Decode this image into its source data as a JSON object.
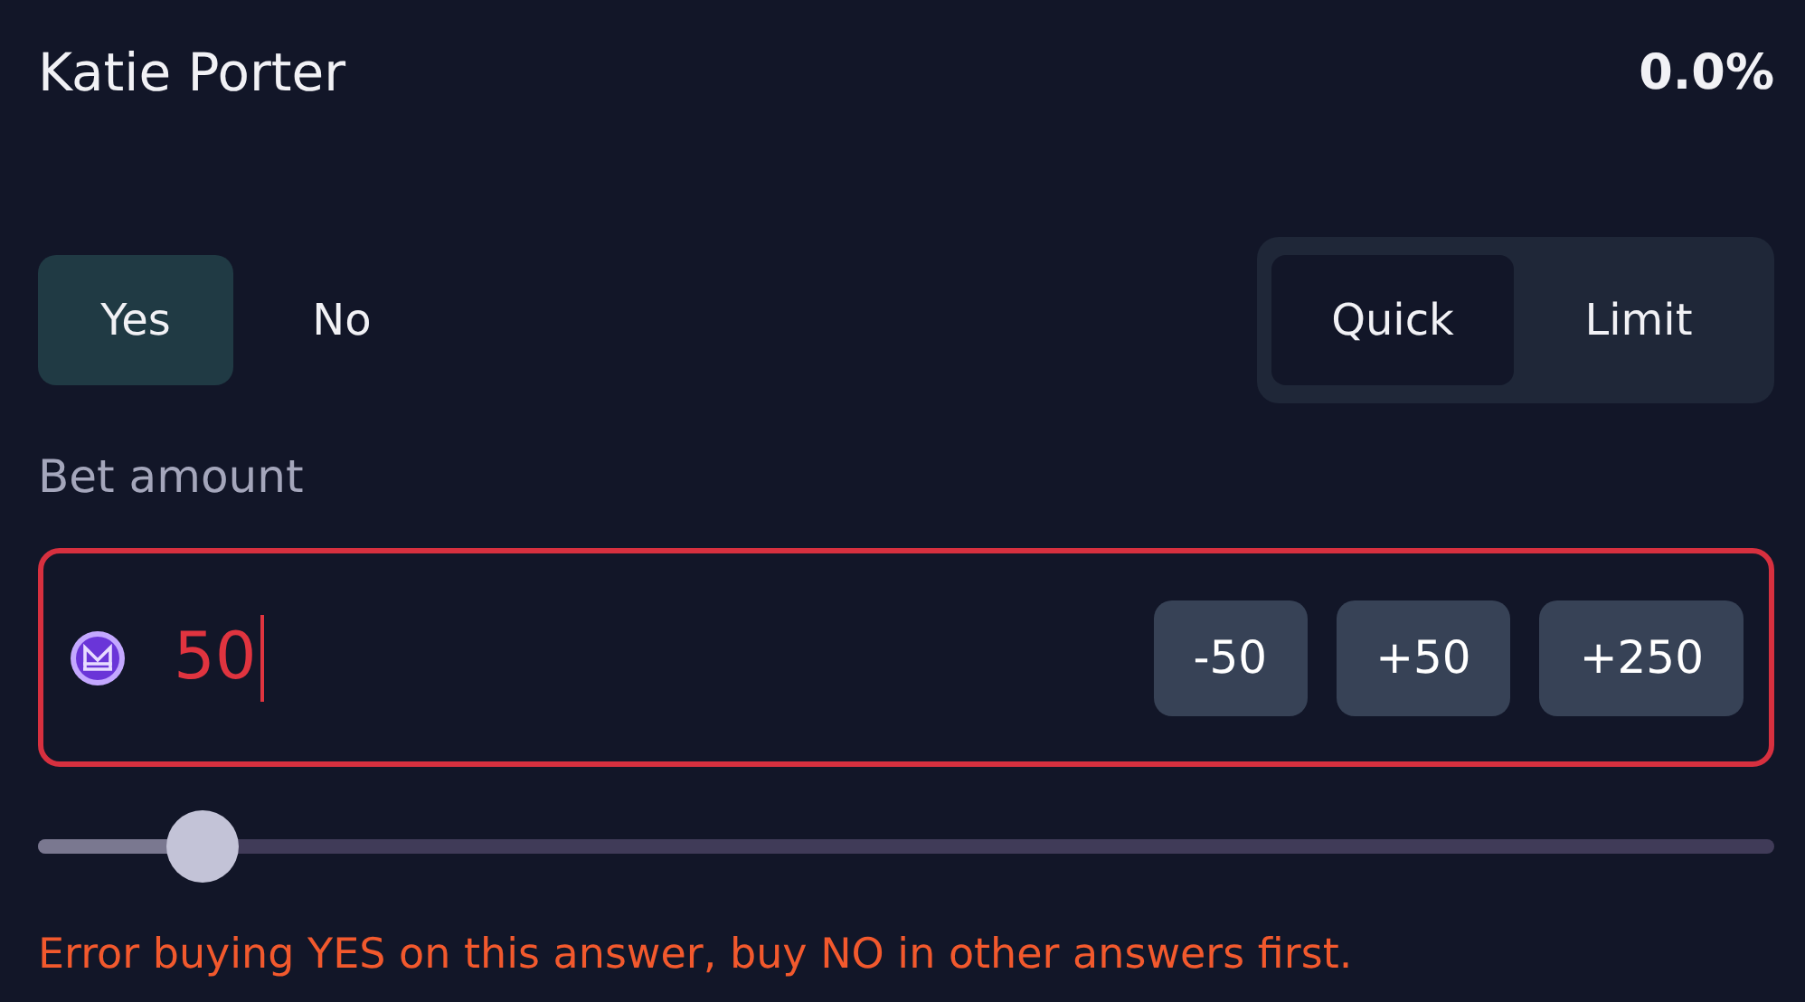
{
  "answer": {
    "name": "Katie Porter",
    "probability": "0.0%"
  },
  "outcome_tabs": [
    {
      "label": "Yes",
      "selected": true
    },
    {
      "label": "No",
      "selected": false
    }
  ],
  "mode_tabs": [
    {
      "label": "Quick",
      "selected": true
    },
    {
      "label": "Limit",
      "selected": false
    }
  ],
  "bet": {
    "label": "Bet amount",
    "value": "50",
    "invalid": true,
    "adjust_buttons": [
      "-50",
      "+50",
      "+250"
    ]
  },
  "slider": {
    "level": 0.095
  },
  "error": "Error buying YES on this answer, buy NO in other answers first."
}
